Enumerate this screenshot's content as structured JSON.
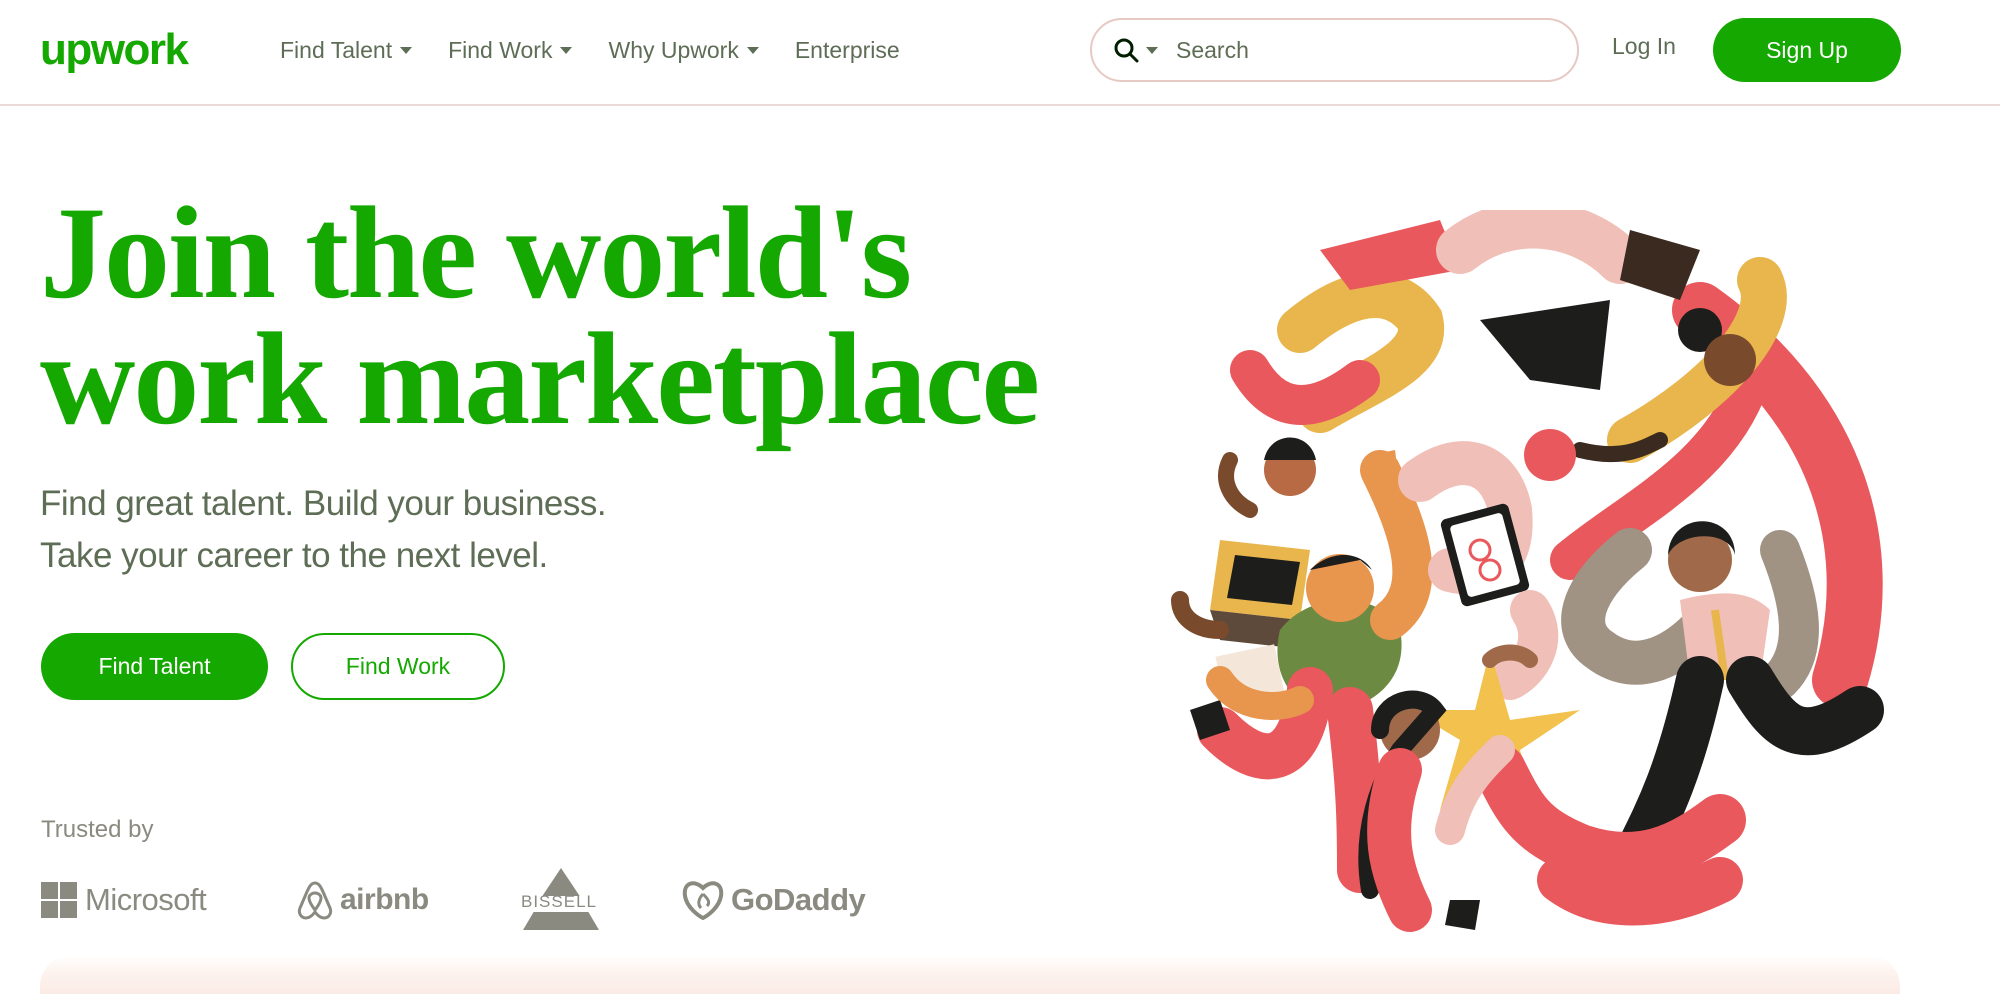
{
  "header": {
    "logo_text": "upwork",
    "nav": [
      {
        "label": "Find Talent",
        "has_dropdown": true
      },
      {
        "label": "Find Work",
        "has_dropdown": true
      },
      {
        "label": "Why Upwork",
        "has_dropdown": true
      },
      {
        "label": "Enterprise",
        "has_dropdown": false
      }
    ],
    "search": {
      "placeholder": "Search",
      "icon": "search-icon"
    },
    "login_label": "Log In",
    "signup_label": "Sign Up"
  },
  "hero": {
    "title_line1": "Join the world's",
    "title_line2": "work marketplace",
    "subtitle_line1": "Find great talent. Build your business.",
    "subtitle_line2": "Take your career to the next level.",
    "primary_button": "Find Talent",
    "secondary_button": "Find Work"
  },
  "trusted": {
    "label": "Trusted by",
    "brands": [
      "Microsoft",
      "airbnb",
      "BISSELL",
      "GoDaddy"
    ]
  },
  "colors": {
    "brand_green": "#14a800",
    "text_muted": "#5e6d55",
    "logo_gray": "#8a8a80"
  }
}
